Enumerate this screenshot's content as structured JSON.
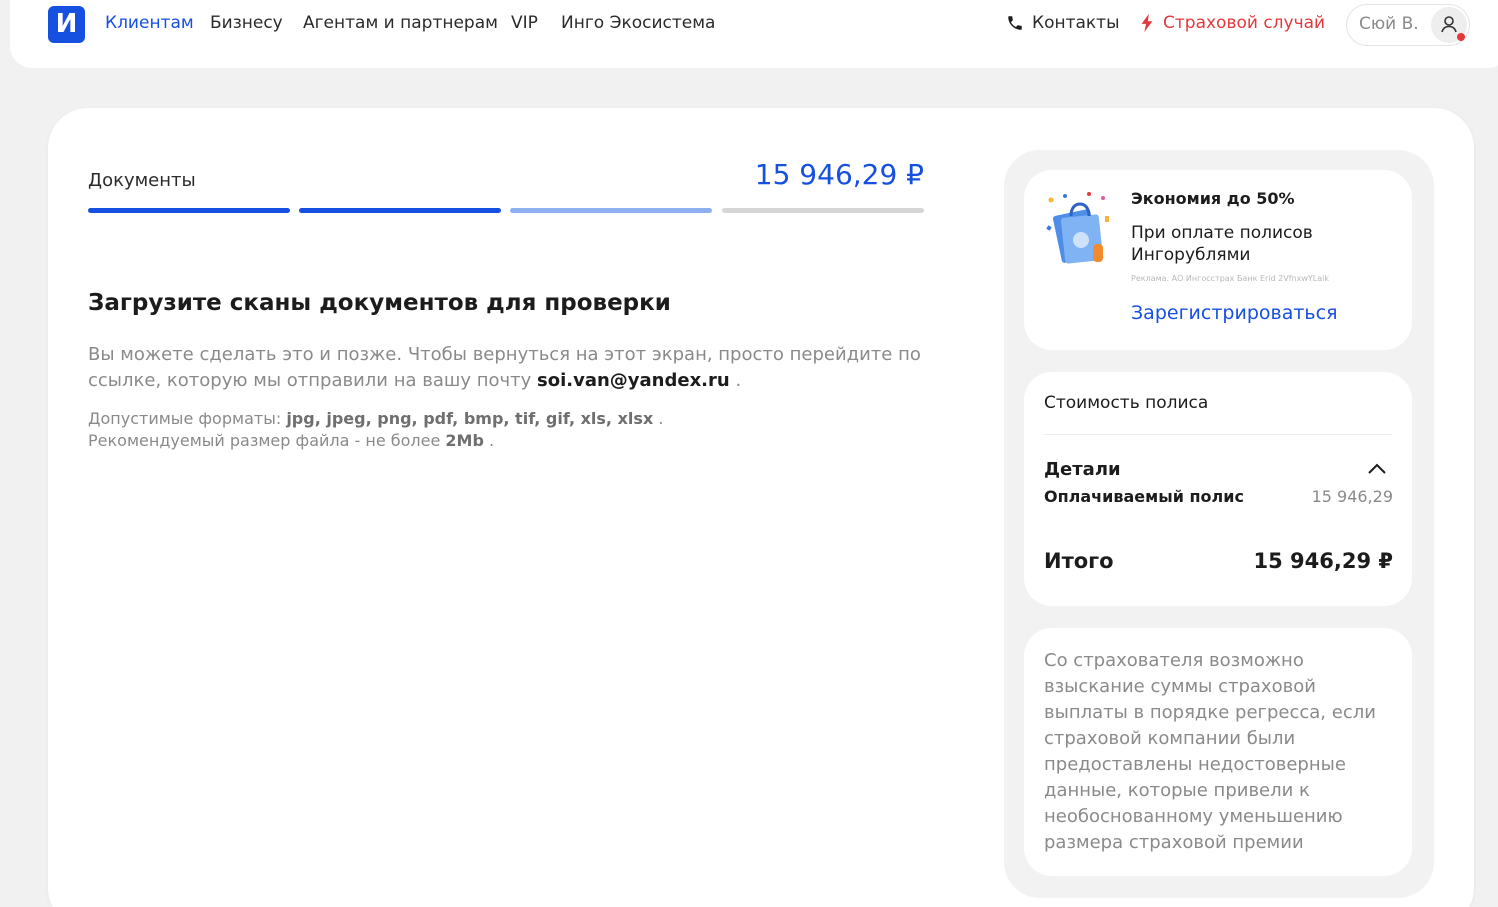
{
  "header": {
    "logo_letter": "И",
    "nav": [
      {
        "label": "Клиентам",
        "active": true
      },
      {
        "label": "Бизнесу",
        "active": false
      },
      {
        "label": "Агентам и партнерам",
        "active": false
      },
      {
        "label": "VIP",
        "active": false
      },
      {
        "label": "Инго Экосистема",
        "active": false
      }
    ],
    "contacts_label": "Контакты",
    "claim_label": "Страховой случай",
    "user_name": "Сюй В."
  },
  "steps": {
    "current_label": "Документы",
    "total_amount": "15 946,29 ₽",
    "segments": [
      "done",
      "done",
      "current",
      "pending"
    ]
  },
  "upload": {
    "heading": "Загрузите сканы документов для проверки",
    "desc_text": "Вы можете сделать это и позже. Чтобы вернуться на этот экран, просто перейдите по ссылке, которую мы отправили на вашу почту",
    "email": "soi.van@yandex.ru",
    "desc_end": ".",
    "formats_label": "Допустимые форматы:",
    "formats_value": "jpg, jpeg, png, pdf, bmp, tif, gif, xls, xlsx",
    "formats_end": ".",
    "size_label": "Рекомендуемый размер файла - не более",
    "size_value": "2Mb",
    "size_end": "."
  },
  "promo": {
    "title": "Экономия до 50%",
    "text": "При оплате полисов Ингорублями",
    "fine_print": "Реклама. АО Ингосстрах Банк Erid 2VfnxwYLaik",
    "link_label": "Зарегистрироваться"
  },
  "cost": {
    "title": "Стоимость полиса",
    "details_label": "Детали",
    "paid_label": "Оплачиваемый полис",
    "paid_value": "15 946,29",
    "total_label": "Итого",
    "total_value": "15 946,29 ₽"
  },
  "notice": {
    "text": "Со страхователя возможно взыскание суммы страховой выплаты в порядке регресса, если страховой компании были предоставлены недостоверные данные, которые привели к необоснованному уменьшению размера страховой премии"
  },
  "colors": {
    "brand": "#1650e0",
    "brand_light": "#8fb0f0",
    "pending": "#d6d6d6",
    "danger": "#e3393c"
  },
  "icons": [
    "phone-icon",
    "lightning-icon",
    "user-icon",
    "chevron-up-icon",
    "shopping-bag-illustration"
  ]
}
